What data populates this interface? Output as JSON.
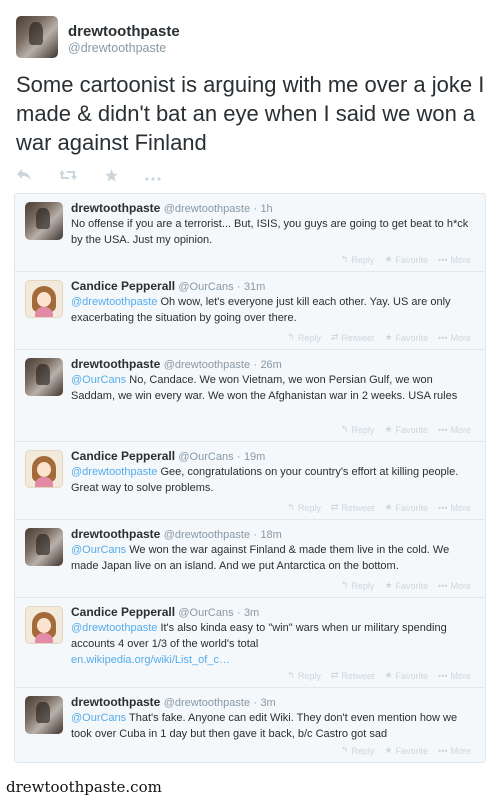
{
  "main_tweet": {
    "name": "drewtoothpaste",
    "handle": "@drewtoothpaste",
    "text": "Some cartoonist is arguing with me over a joke I made & didn't bat an eye when I said we won a war against Finland",
    "actions": {
      "reply_icon": "reply-icon",
      "retweet_icon": "retweet-icon",
      "favorite_icon": "star-icon",
      "more_icon": "more-icon"
    }
  },
  "replies": [
    {
      "name": "drewtoothpaste",
      "handle": "@drewtoothpaste",
      "time": "1h",
      "mention": "",
      "text": "No offense if you are a terrorist... But, ISIS, you guys are going to get beat to h*ck by the USA. Just my opinion.",
      "link": "",
      "actions": [
        "Reply",
        "Favorite",
        "More"
      ]
    },
    {
      "name": "Candice Pepperall",
      "handle": "@OurCans",
      "time": "31m",
      "mention": "@drewtoothpaste",
      "text": " Oh wow, let's everyone just kill each other. Yay. US are only exacerbating the situation by going over there.",
      "link": "",
      "actions": [
        "Reply",
        "Retweet",
        "Favorite",
        "More"
      ]
    },
    {
      "name": "drewtoothpaste",
      "handle": "@drewtoothpaste",
      "time": "26m",
      "mention": "@OurCans",
      "text": " No, Candace. We won Vietnam, we won Persian Gulf, we won Saddam, we win every war. We won the Afghanistan war in 2 weeks. USA rules",
      "link": "",
      "actions": [
        "Reply",
        "Favorite",
        "More"
      ]
    },
    {
      "name": "Candice Pepperall",
      "handle": "@OurCans",
      "time": "19m",
      "mention": "@drewtoothpaste",
      "text": " Gee, congratulations on your country's effort at killing people. Great way to solve problems.",
      "link": "",
      "actions": [
        "Reply",
        "Retweet",
        "Favorite",
        "More"
      ]
    },
    {
      "name": "drewtoothpaste",
      "handle": "@drewtoothpaste",
      "time": "18m",
      "mention": "@OurCans",
      "text": " We won the war against Finland & made them live in the cold. We made Japan live on an island. And we put Antarctica on the bottom.",
      "link": "",
      "actions": [
        "Reply",
        "Favorite",
        "More"
      ]
    },
    {
      "name": "Candice Pepperall",
      "handle": "@OurCans",
      "time": "3m",
      "mention": "@drewtoothpaste",
      "text": " It's also kinda easy to \"win\" wars when ur military spending accounts 4 over 1/3 of the world's total",
      "link": "en.wikipedia.org/wiki/List_of_c…",
      "actions": [
        "Reply",
        "Retweet",
        "Favorite",
        "More"
      ]
    },
    {
      "name": "drewtoothpaste",
      "handle": "@drewtoothpaste",
      "time": "3m",
      "mention": "@OurCans",
      "text": " That's fake. Anyone can edit Wiki. They don't even mention how we took over Cuba in 1 day but then gave it back, b/c Castro got sad",
      "link": "",
      "actions": [
        "Reply",
        "Favorite",
        "More"
      ]
    }
  ],
  "footer": {
    "brand": "drewtoothpaste.com"
  }
}
